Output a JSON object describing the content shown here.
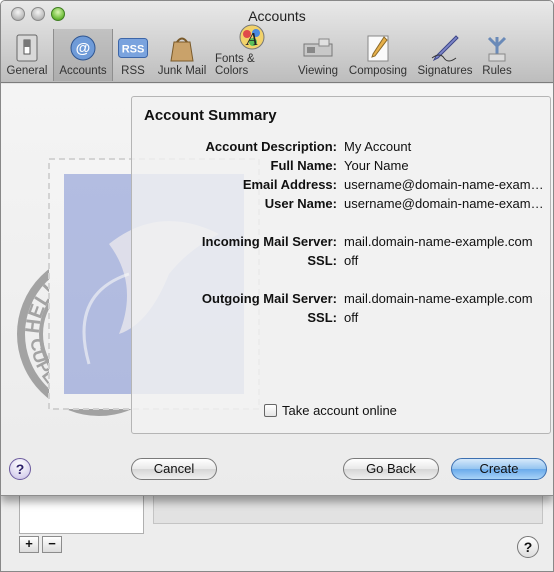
{
  "window": {
    "title": "Accounts"
  },
  "toolbar": {
    "items": [
      {
        "label": "General",
        "icon": "general-switch-icon"
      },
      {
        "label": "Accounts",
        "icon": "at-sign-icon"
      },
      {
        "label": "RSS",
        "icon": "rss-icon"
      },
      {
        "label": "Junk Mail",
        "icon": "junk-mail-bag-icon"
      },
      {
        "label": "Fonts & Colors",
        "icon": "fonts-colors-icon"
      },
      {
        "label": "Viewing",
        "icon": "viewing-icon"
      },
      {
        "label": "Composing",
        "icon": "composing-pencil-icon"
      },
      {
        "label": "Signatures",
        "icon": "signatures-pen-icon"
      },
      {
        "label": "Rules",
        "icon": "rules-icon"
      }
    ],
    "active": "Accounts"
  },
  "summary": {
    "title": "Account Summary",
    "rows": [
      {
        "label": "Account Description:",
        "value": "My Account"
      },
      {
        "label": "Full Name:",
        "value": "Your Name"
      },
      {
        "label": "Email Address:",
        "value": "username@domain-name-example.com"
      },
      {
        "label": "User Name:",
        "value": "username@domain-name-example.com"
      },
      {
        "label": "Incoming Mail Server:",
        "value": "mail.domain-name-example.com"
      },
      {
        "label": "SSL:",
        "value": "off"
      },
      {
        "label": "Outgoing Mail Server:",
        "value": "mail.domain-name-example.com"
      },
      {
        "label": "SSL:",
        "value": "off"
      }
    ],
    "take_online_label": "Take account online",
    "take_online_checked": false
  },
  "buttons": {
    "help": "?",
    "cancel": "Cancel",
    "back": "Go Back",
    "create": "Create"
  },
  "background": {
    "add": "+",
    "remove": "−",
    "help": "?"
  },
  "stamp": {
    "text_top": "HELLO FROM",
    "text_bottom": "CUPERTINO, CA"
  }
}
